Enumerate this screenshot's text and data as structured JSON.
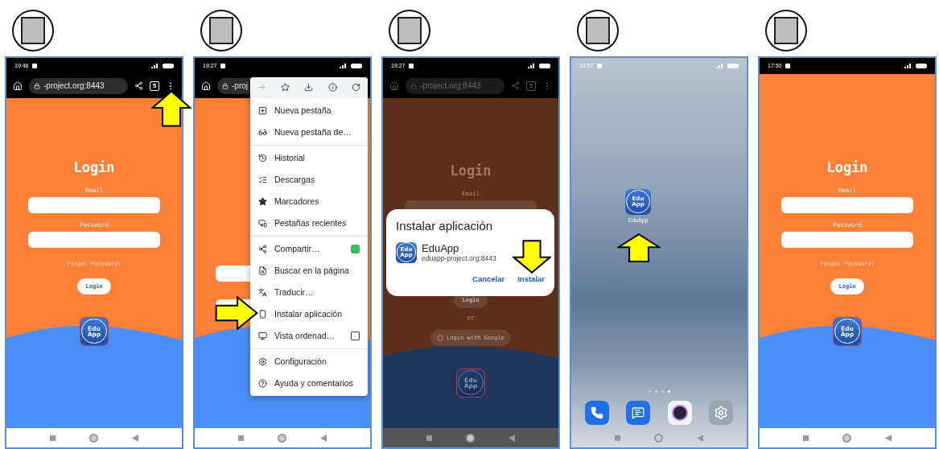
{
  "screens": [
    {
      "kind": "browser",
      "dimmed": false,
      "arrow": {
        "kind": "up"
      },
      "status": {
        "time": "19:46"
      },
      "toolbar": {
        "url": "-project.org:8443",
        "tab_count": "5"
      },
      "page": {
        "kind": "login",
        "title": "Login",
        "fields": [
          {
            "label": "Email"
          },
          {
            "label": "Password"
          }
        ],
        "link": "Forgot Password?",
        "button": "Login",
        "logo": [
          "Edu",
          "App"
        ]
      }
    },
    {
      "kind": "browser",
      "dimmed": false,
      "arrow": {
        "kind": "right"
      },
      "status": {
        "time": "19:27"
      },
      "toolbar": {
        "url": "-proj"
      },
      "page": {
        "kind": "login_covered"
      },
      "menu": {
        "actions": [
          {
            "disabled": true
          },
          {
            "disabled": false
          },
          {
            "disabled": false
          },
          {
            "disabled": false
          },
          {
            "disabled": false
          }
        ],
        "groups": [
          [
            {
              "label": "Nueva pestaña",
              "kind": "plain"
            },
            {
              "label": "Nueva pestaña de…",
              "kind": "plain"
            }
          ],
          [
            {
              "label": "Historial",
              "kind": "plain"
            },
            {
              "label": "Descargas",
              "kind": "plain"
            },
            {
              "label": "Marcadores",
              "kind": "plain"
            },
            {
              "label": "Pestañas recientes",
              "kind": "plain"
            }
          ],
          [
            {
              "label": "Compartir…",
              "kind": "share"
            },
            {
              "label": "Buscar en la página",
              "kind": "plain"
            },
            {
              "label": "Traducir…",
              "kind": "plain"
            },
            {
              "label": "Instalar aplicación",
              "kind": "plain"
            },
            {
              "label": "Vista ordenad…",
              "kind": "toggle",
              "checked": false
            }
          ],
          [
            {
              "label": "Configuración",
              "kind": "plain"
            },
            {
              "label": "Ayuda y comentarios",
              "kind": "plain"
            }
          ]
        ]
      }
    },
    {
      "kind": "browser",
      "dimmed": true,
      "arrow": {
        "kind": "down"
      },
      "status": {
        "time": "19:27"
      },
      "toolbar": {
        "url": "-project.org:8443",
        "tab_count": "5"
      },
      "page": {
        "kind": "login_dialog",
        "title": "Login",
        "fields": [
          {
            "label": "Email"
          }
        ],
        "button": "Login",
        "separator": "or",
        "google_button": "Login with Google",
        "logo": [
          "Edu",
          "App"
        ]
      },
      "dialog": {
        "title": "Instalar aplicación",
        "app_name": "EduApp",
        "app_url": "eduapp-project.org:8443",
        "logo": [
          "Edu",
          "App"
        ],
        "buttons": [
          "Cancelar",
          "Instalar"
        ]
      }
    },
    {
      "kind": "home",
      "arrow": {
        "kind": "up"
      },
      "status": {
        "time": "19:57"
      },
      "home": {
        "app": {
          "label": "EduApp",
          "logo": [
            "Edu",
            "App"
          ]
        },
        "pages": [
          {
            "selected": false
          },
          {
            "selected": false
          },
          {
            "selected": false
          },
          {
            "selected": true
          }
        ]
      }
    },
    {
      "kind": "standalone",
      "status": {
        "time": "17:50"
      },
      "page": {
        "kind": "login",
        "title": "Login",
        "fields": [
          {
            "label": "Email"
          },
          {
            "label": "Password"
          }
        ],
        "link": "Forgot Password?",
        "button": "Login",
        "logo": [
          "Edu",
          "App"
        ]
      }
    }
  ]
}
